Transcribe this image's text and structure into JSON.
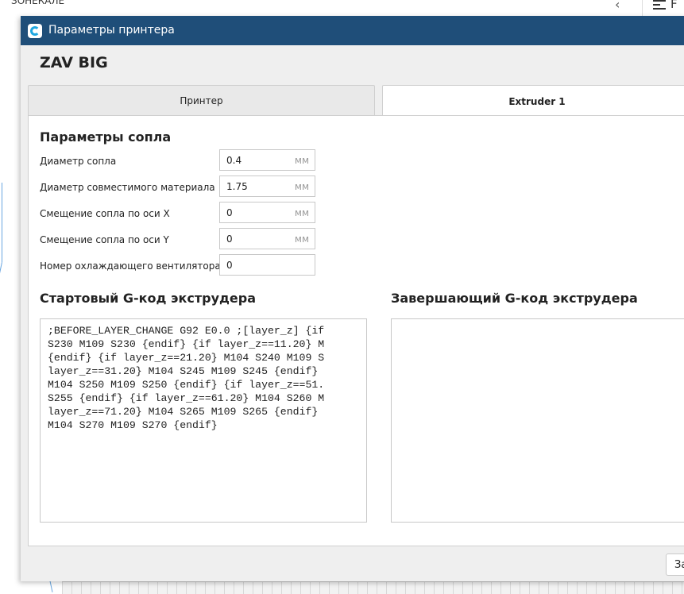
{
  "background": {
    "top_text": "ЗОНЕКАЛЕ",
    "right_letter": "F"
  },
  "dialog": {
    "title": "Параметры принтера",
    "printer_name": "ZAV BIG",
    "tabs": [
      {
        "label": "Принтер",
        "active": false
      },
      {
        "label": "Extruder 1",
        "active": true
      }
    ],
    "nozzle_section": {
      "title": "Параметры сопла",
      "fields": [
        {
          "label": "Диаметр сопла",
          "value": "0.4",
          "unit": "мм"
        },
        {
          "label": "Диаметр совместимого материала",
          "value": "1.75",
          "unit": "мм"
        },
        {
          "label": "Смещение сопла по оси X",
          "value": "0",
          "unit": "мм"
        },
        {
          "label": "Смещение сопла по оси Y",
          "value": "0",
          "unit": "мм"
        },
        {
          "label": "Номер охлаждающего вентилятора",
          "value": "0",
          "unit": ""
        }
      ]
    },
    "start_gcode": {
      "title": "Стартовый G-код экструдера",
      "text": ";BEFORE_LAYER_CHANGE G92 E0.0 ;[layer_z] {if\nS230 M109 S230 {endif} {if layer_z==11.20} M\n{endif} {if layer_z==21.20} M104 S240 M109 S\nlayer_z==31.20} M104 S245 M109 S245 {endif}\nM104 S250 M109 S250 {endif} {if layer_z==51.\nS255 {endif} {if layer_z==61.20} M104 S260 M\nlayer_z==71.20} M104 S265 M109 S265 {endif}\nM104 S270 M109 S270 {endif}"
    },
    "end_gcode": {
      "title": "Завершающий G-код экструдера",
      "text": ""
    },
    "close_button_label": "За"
  }
}
